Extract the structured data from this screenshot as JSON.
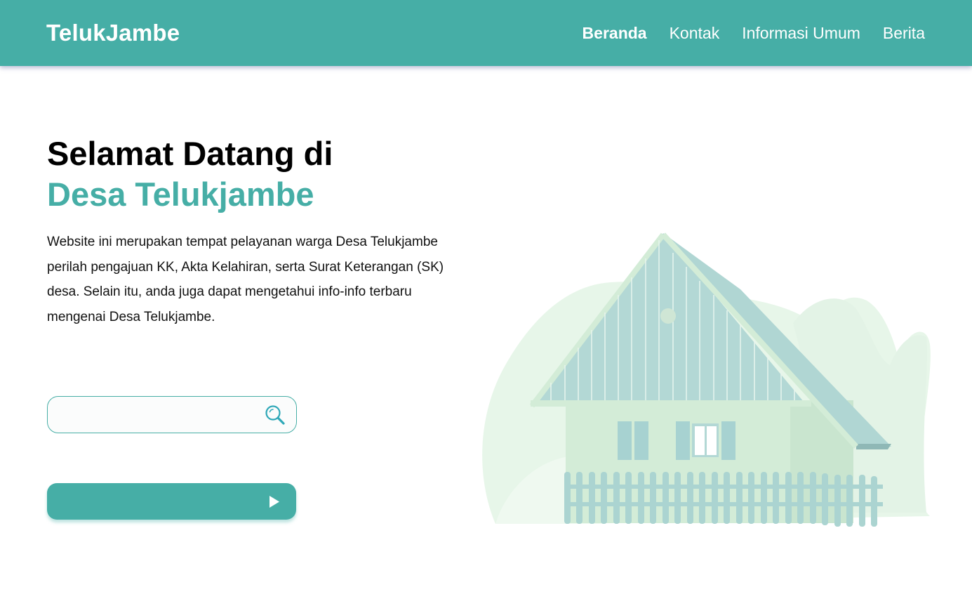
{
  "navbar": {
    "brand": "TelukJambe",
    "links": [
      {
        "label": "Beranda",
        "active": true
      },
      {
        "label": "Kontak",
        "active": false
      },
      {
        "label": "Informasi Umum",
        "active": false
      },
      {
        "label": "Berita",
        "active": false
      }
    ]
  },
  "hero": {
    "title_line1": "Selamat Datang di",
    "title_line2": "Desa Telukjambe",
    "description": "Website ini merupakan tempat pelayanan warga Desa Telukjambe perilah pengajuan KK, Akta Kelahiran, serta Surat Keterangan (SK) desa. Selain itu, anda juga dapat mengetahui info-info terbaru mengenai Desa Telukjambe."
  },
  "search": {
    "value": "",
    "placeholder": "",
    "icon": "search-icon"
  },
  "cta": {
    "label": "",
    "icon": "play-icon"
  },
  "illustration": {
    "subject": "house-illustration"
  },
  "colors": {
    "primary": "#46aea6",
    "navbar_text": "#ffffff",
    "heading": "#000000",
    "roof": "#b4d8d6",
    "house_body": "#d4edd8",
    "background_shape": "#e8f6ea"
  }
}
